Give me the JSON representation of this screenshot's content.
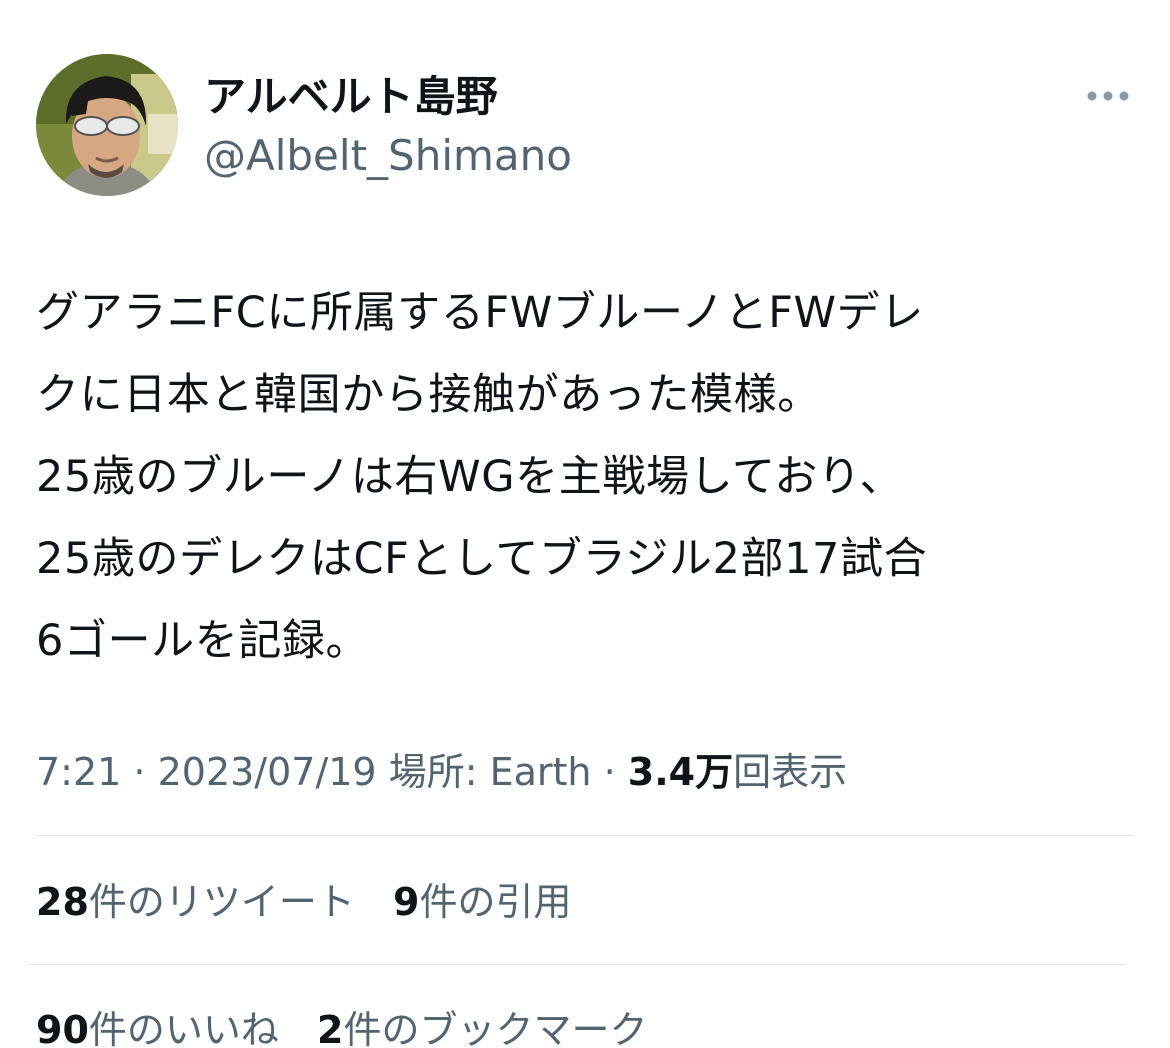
{
  "user": {
    "display_name": "アルベルト島野",
    "handle": "@Albelt_Shimano",
    "avatar_icon": "profile-photo"
  },
  "header": {
    "more_icon": "more-horizontal-icon"
  },
  "tweet": {
    "lines": [
      "グアラニFCに所属するFWブルーノとFWデレ",
      "クに日本と韓国から接触があった模様。",
      "25歳のブルーノは右WGを主戦場しており、",
      "25歳のデレクはCFとしてブラジル2部17試合",
      "6ゴールを記録。"
    ]
  },
  "meta": {
    "time": "7:21",
    "separator": " · ",
    "date": "2023/07/19",
    "location_label": "場所: Earth",
    "views_count": "3.4万",
    "views_label": "回表示"
  },
  "stats": {
    "retweets": {
      "count": "28",
      "label": "件のリツイート"
    },
    "quotes": {
      "count": "9",
      "label": "件の引用"
    },
    "likes": {
      "count": "90",
      "label": "件のいいね"
    },
    "bookmarks": {
      "count": "2",
      "label": "件のブックマーク"
    }
  },
  "colors": {
    "text_primary": "#0f1419",
    "text_secondary": "#536471",
    "divider": "#e3e6e8",
    "background": "#ffffff"
  }
}
